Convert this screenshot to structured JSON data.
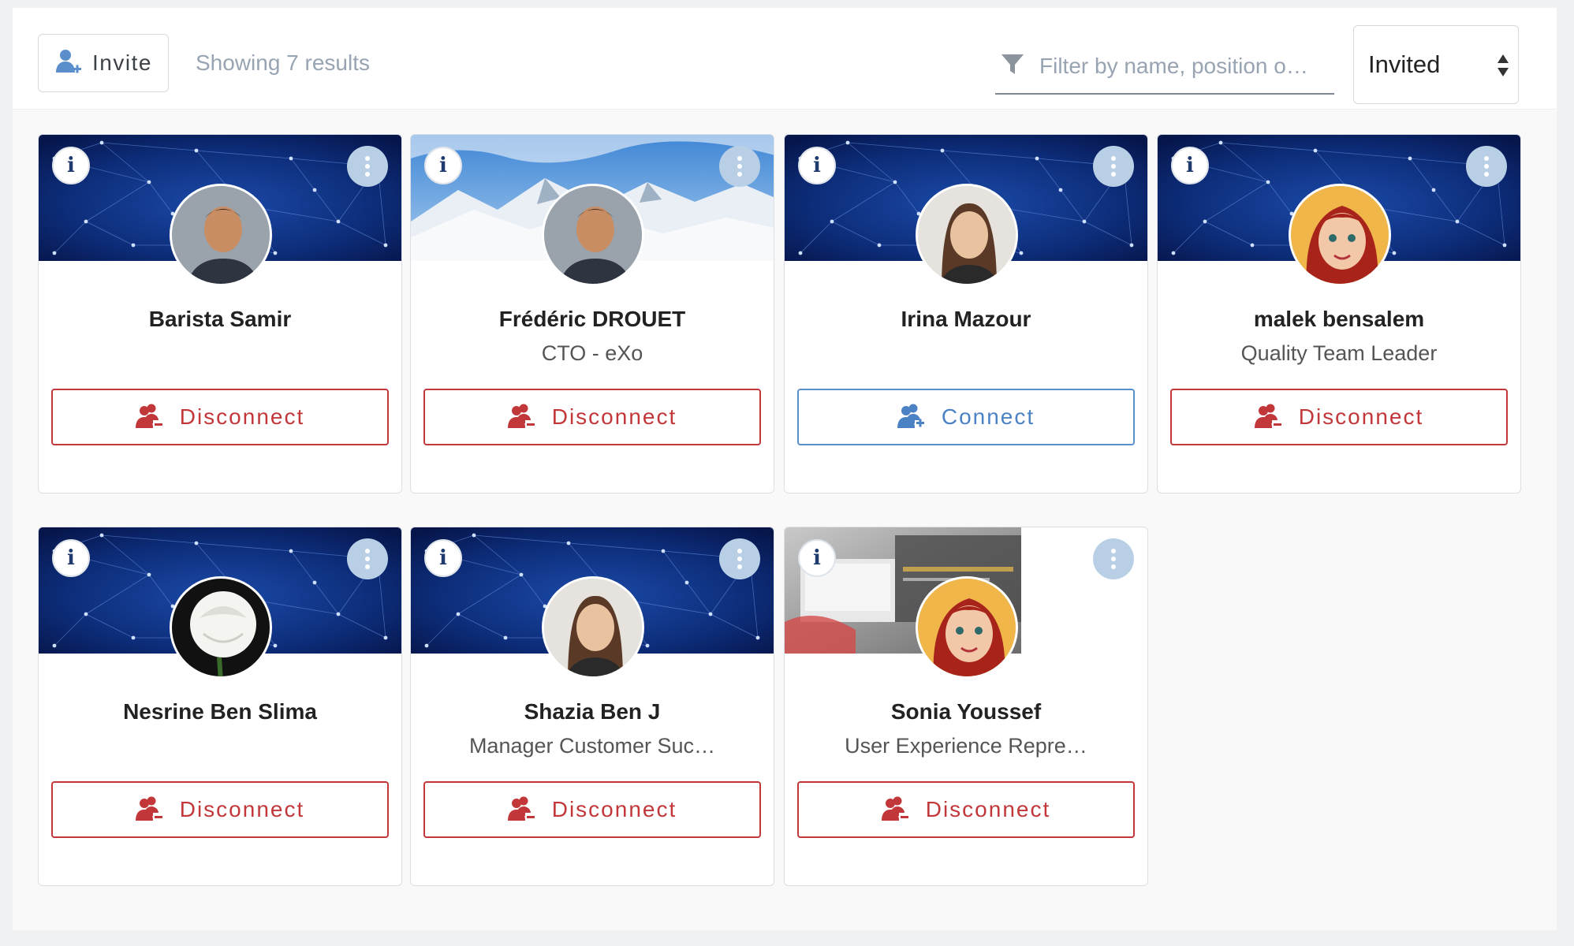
{
  "toolbar": {
    "invite_label": "Invite",
    "results_text": "Showing 7 results",
    "filter_placeholder": "Filter by name, position o…",
    "select_value": "Invited"
  },
  "colors": {
    "disconnect": "#c2373a",
    "connect": "#4b82c3",
    "muted_text": "#98a4b2",
    "kebab_bg": "#b8cfe6"
  },
  "icons": {
    "invite": "user-plus-icon",
    "filter": "funnel-icon",
    "select": "sort-arrows-icon",
    "info": "info-icon",
    "menu": "kebab-menu-icon",
    "disconnect": "user-minus-icon",
    "connect": "user-plus-icon"
  },
  "cards": [
    {
      "name": "Barista Samir",
      "position": "",
      "action": "Disconnect",
      "banner": "network",
      "avatar": "man-photo"
    },
    {
      "name": "Frédéric DROUET",
      "position": "CTO - eXo",
      "action": "Disconnect",
      "banner": "mountains",
      "avatar": "man-photo"
    },
    {
      "name": "Irina Mazour",
      "position": "",
      "action": "Connect",
      "banner": "network",
      "avatar": "woman-photo"
    },
    {
      "name": "malek bensalem",
      "position": "Quality Team Leader",
      "action": "Disconnect",
      "banner": "network",
      "avatar": "cartoon-avatar"
    },
    {
      "name": "Nesrine Ben Slima",
      "position": "",
      "action": "Disconnect",
      "banner": "network",
      "avatar": "white-rose"
    },
    {
      "name": "Shazia Ben J",
      "position": "Manager Customer Suc…",
      "action": "Disconnect",
      "banner": "network",
      "avatar": "woman-photo"
    },
    {
      "name": "Sonia Youssef",
      "position": "User Experience Repre…",
      "action": "Disconnect",
      "banner": "office-photo",
      "avatar": "cartoon-avatar"
    }
  ]
}
